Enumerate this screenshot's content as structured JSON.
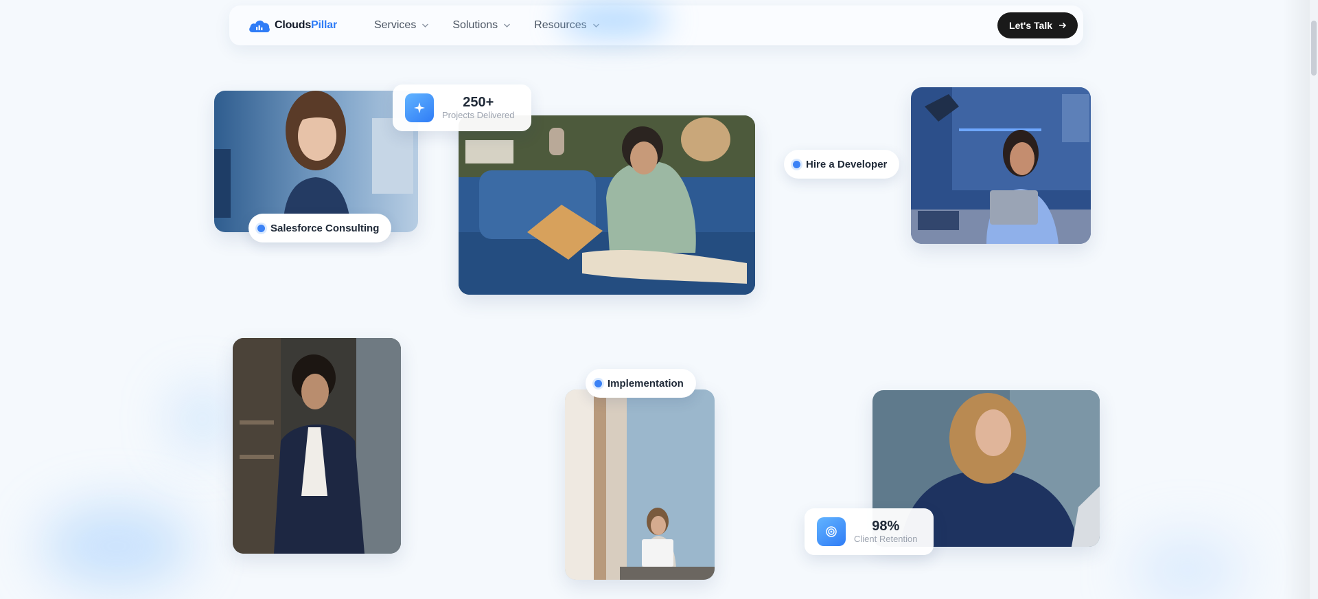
{
  "navbar": {
    "logo": {
      "text_main": "Clouds",
      "text_accent": "Pillar"
    },
    "menu": [
      {
        "label": "Services"
      },
      {
        "label": "Solutions"
      },
      {
        "label": "Resources"
      }
    ],
    "cta_label": "Let's Talk"
  },
  "tags": {
    "salesforce": "Salesforce Consulting",
    "hire": "Hire a Developer",
    "implementation": "Implementation"
  },
  "stats": {
    "projects": {
      "value": "250+",
      "label": "Projects Delivered",
      "icon": "sparkle-icon"
    },
    "retention": {
      "value": "98%",
      "label": "Client Retention",
      "icon": "target-icon"
    }
  },
  "photos": [
    {
      "name": "photo-woman-office",
      "subject": "woman in navy sweater smiling in office"
    },
    {
      "name": "photo-man-sofa-laptop",
      "subject": "man on blue sofa typing on laptop"
    },
    {
      "name": "photo-woman-desk-laptop",
      "subject": "woman at desk with laptop and lamp"
    },
    {
      "name": "photo-man-suit",
      "subject": "man in navy suit in office"
    },
    {
      "name": "photo-woman-window",
      "subject": "woman at laptop by window"
    },
    {
      "name": "photo-woman-curly-hair",
      "subject": "woman with curly hair at laptop"
    }
  ],
  "colors": {
    "accent": "#2f7cf6",
    "cta_bg": "#1a1a1a",
    "page_bg": "#f5f9fd"
  }
}
